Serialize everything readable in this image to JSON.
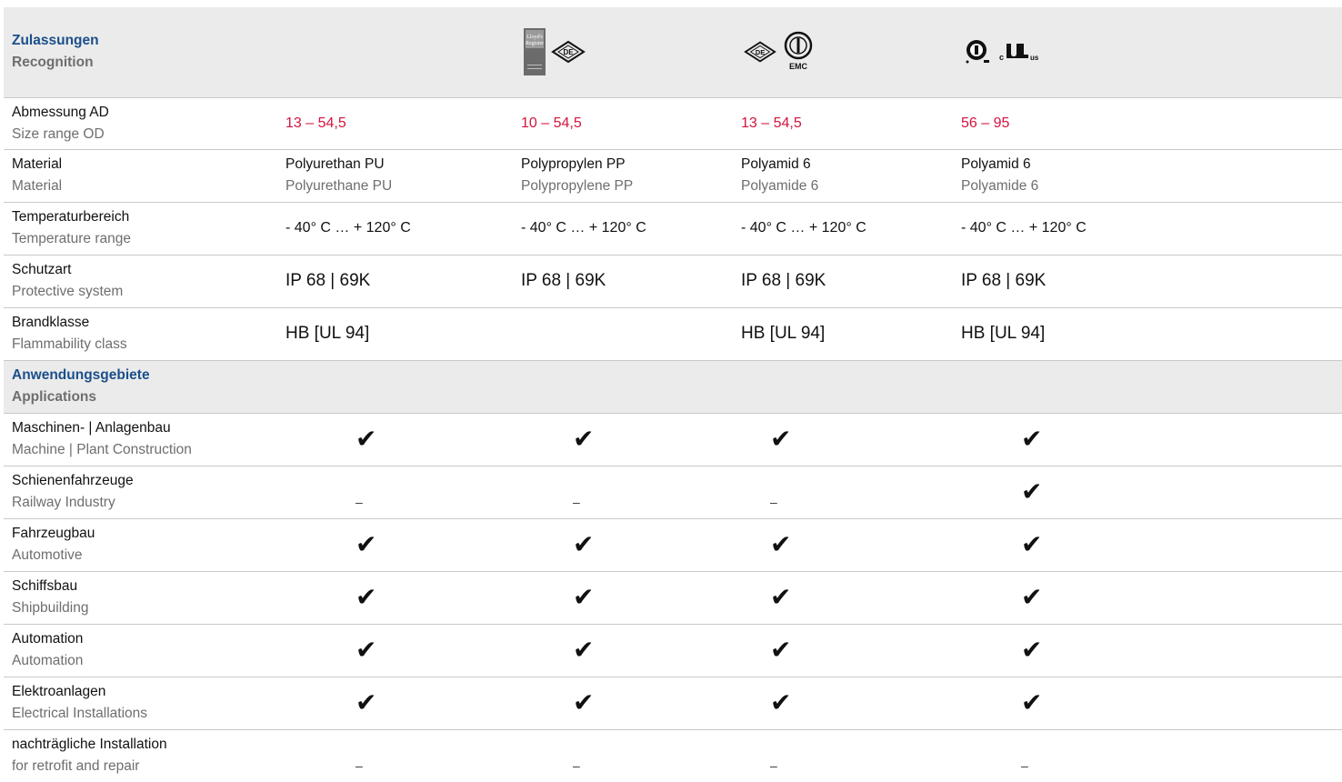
{
  "recognition": {
    "title_de": "Zulassungen",
    "title_en": "Recognition",
    "columns": [
      {
        "logos": []
      },
      {
        "logos": [
          "lloyds-register-logo",
          "vde-mark-logo"
        ],
        "lloyds_text": [
          "Lloyd's",
          "Register"
        ],
        "vde_text": "DE"
      },
      {
        "logos": [
          "vde-mark-logo",
          "vde-emc-logo"
        ],
        "vde_text": "DE",
        "emc_text": "EMC"
      },
      {
        "logos": [
          "csa-logo",
          "ul-recognized-logo"
        ],
        "ul_text": "us",
        "ul_prefix": "c"
      }
    ]
  },
  "properties": [
    {
      "de": "Abmessung AD",
      "en": "Size range OD",
      "kind": "size",
      "values": [
        "13 – 54,5",
        "10 – 54,5",
        "13 – 54,5",
        "56 – 95"
      ]
    },
    {
      "de": "Material",
      "en": "Material",
      "kind": "material",
      "values": [
        {
          "de": "Polyurethan PU",
          "en": "Polyurethane PU"
        },
        {
          "de": "Polypropylen PP",
          "en": "Polypropylene PP"
        },
        {
          "de": "Polyamid 6",
          "en": "Polyamide 6"
        },
        {
          "de": "Polyamid 6",
          "en": "Polyamide 6"
        }
      ]
    },
    {
      "de": "Temperaturbereich",
      "en": "Temperature range",
      "kind": "temp",
      "values": [
        "- 40° C … + 120° C",
        "- 40° C … + 120° C",
        "- 40° C … + 120° C",
        "- 40° C … + 120° C"
      ]
    },
    {
      "de": "Schutzart",
      "en": "Protective system",
      "kind": "big",
      "values": [
        "IP 68 | 69K",
        "IP 68 | 69K",
        "IP 68 | 69K",
        "IP 68 | 69K"
      ]
    },
    {
      "de": "Brandklasse",
      "en": "Flammability class",
      "kind": "big",
      "values": [
        "HB [UL 94]",
        "",
        "HB [UL 94]",
        "HB [UL 94]"
      ]
    }
  ],
  "applications": {
    "title_de": "Anwendungsgebiete",
    "title_en": "Applications",
    "check_symbol": "✔",
    "dash_symbol": "–",
    "rows": [
      {
        "de": "Maschinen- | Anlagenbau",
        "en": "Machine | Plant Construction",
        "marks": [
          "check",
          "check",
          "check",
          "check"
        ]
      },
      {
        "de": "Schienenfahrzeuge",
        "en": "Railway Industry",
        "marks": [
          "dash",
          "dash",
          "dash",
          "check"
        ]
      },
      {
        "de": "Fahrzeugbau",
        "en": "Automotive",
        "marks": [
          "check",
          "check",
          "check",
          "check"
        ]
      },
      {
        "de": "Schiffsbau",
        "en": "Shipbuilding",
        "marks": [
          "check",
          "check",
          "check",
          "check"
        ]
      },
      {
        "de": "Automation",
        "en": "Automation",
        "marks": [
          "check",
          "check",
          "check",
          "check"
        ]
      },
      {
        "de": "Elektroanlagen",
        "en": "Electrical Installations",
        "marks": [
          "check",
          "check",
          "check",
          "check"
        ]
      },
      {
        "de": "nachträgliche Installation",
        "en": "for retrofit and repair",
        "marks": [
          "dash",
          "dash",
          "dash",
          "dash"
        ]
      }
    ]
  },
  "colors": {
    "section_title": "#1b4f8a",
    "section_bg": "#ebebeb",
    "size_value": "#d4143e",
    "english_text": "#6e6e6e",
    "rule": "#c9c9c9"
  }
}
